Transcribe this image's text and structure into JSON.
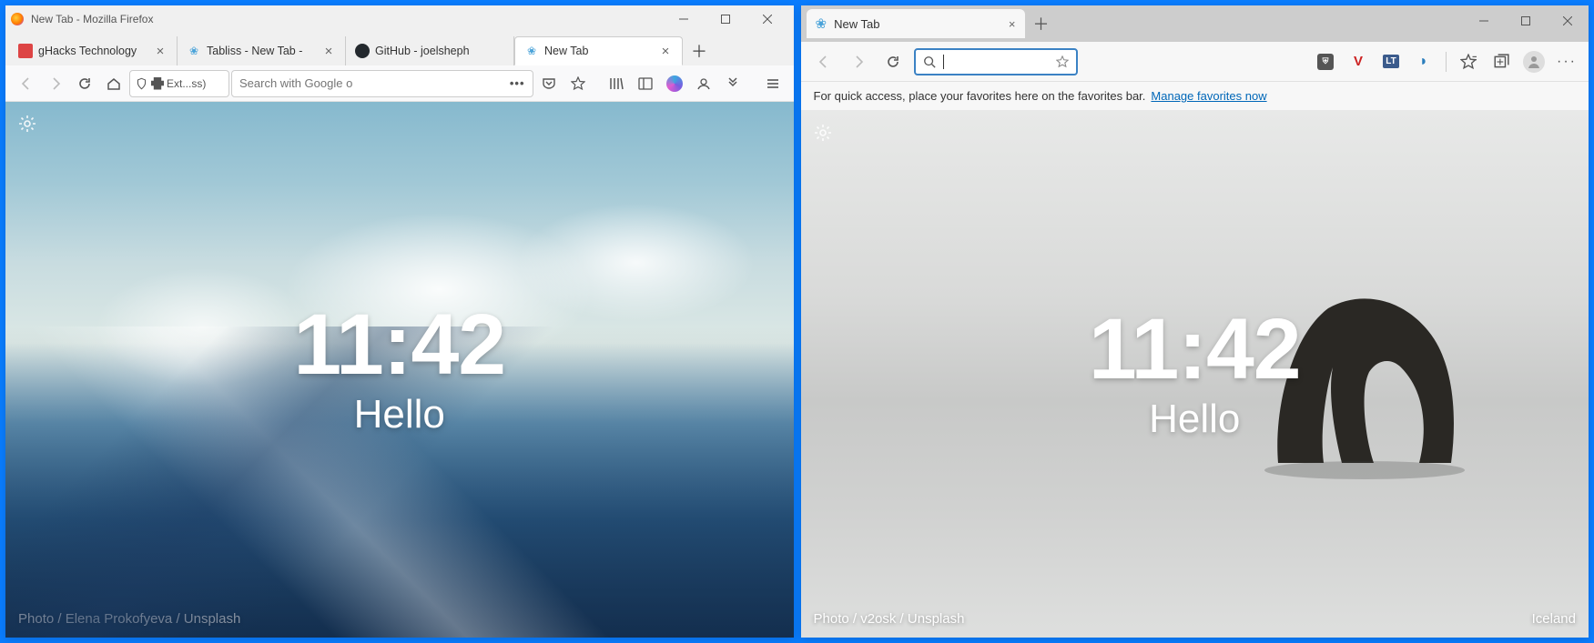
{
  "firefox": {
    "window_title": "New Tab - Mozilla Firefox",
    "tabs": [
      {
        "label": "gHacks Technology"
      },
      {
        "label": "Tabliss - New Tab -"
      },
      {
        "label": "GitHub - joelsheph"
      },
      {
        "label": "New Tab"
      }
    ],
    "url_ext_label": "Ext...ss)",
    "search_placeholder": "Search with Google o",
    "content": {
      "time": "11:42",
      "greeting": "Hello",
      "credit": "Photo / Elena Prokofyeva / Unsplash"
    }
  },
  "edge": {
    "tab_label": "New Tab",
    "favorites_hint": "For quick access, place your favorites here on the favorites bar.",
    "manage_link": "Manage favorites now",
    "content": {
      "time": "11:42",
      "greeting": "Hello",
      "credit": "Photo / v2osk / Unsplash",
      "location": "Iceland"
    }
  }
}
